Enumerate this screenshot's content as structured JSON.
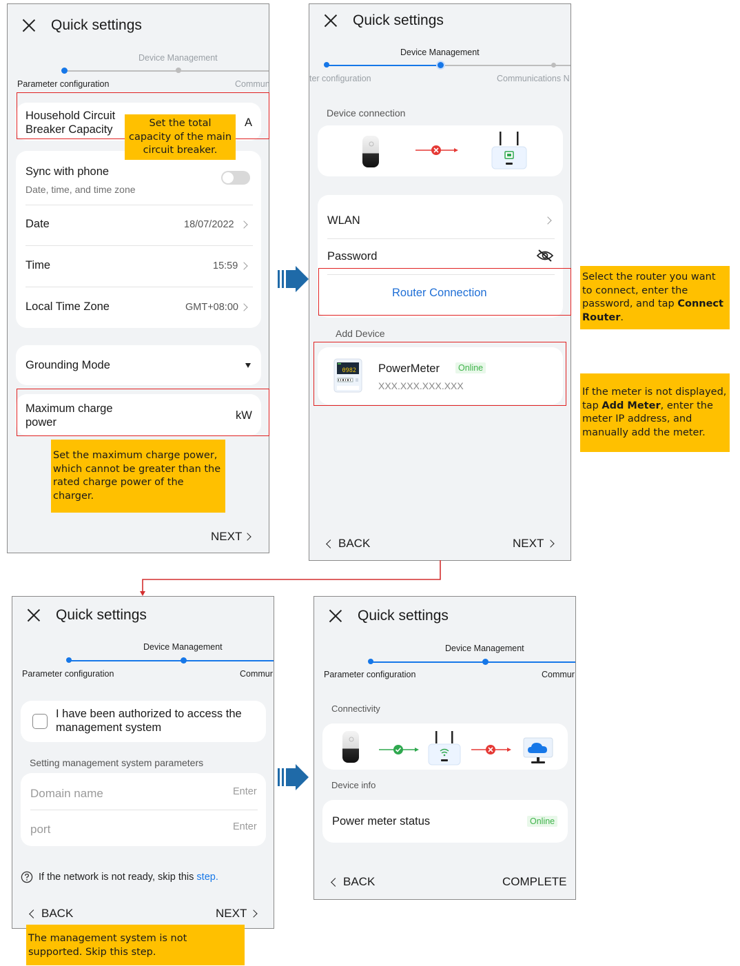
{
  "screen1": {
    "title": "Quick settings",
    "steps": {
      "device_management": "Device Management",
      "parameter_configuration": "Parameter configuration",
      "communications": "Commun"
    },
    "breaker": {
      "label_line1": "Household Circuit",
      "label_line2": "Breaker Capacity",
      "unit": "A"
    },
    "sync": {
      "label": "Sync with phone",
      "sub": "Date, time, and time zone"
    },
    "date": {
      "label": "Date",
      "value": "18/07/2022"
    },
    "time": {
      "label": "Time",
      "value": "15:59"
    },
    "timezone": {
      "label": "Local Time Zone",
      "value": "GMT+08:00"
    },
    "grounding": {
      "label": "Grounding Mode"
    },
    "max_power": {
      "label_line1": "Maximum charge",
      "label_line2": "power",
      "unit": "kW"
    },
    "next": "NEXT"
  },
  "screen2": {
    "title": "Quick settings",
    "steps": {
      "device_management": "Device Management",
      "parameter_configuration": "ter configuration",
      "communications": "Communications N"
    },
    "device_connection": "Device connection",
    "wlan": "WLAN",
    "password": "Password",
    "router_connection": "Router Connection",
    "add_device": "Add Device",
    "meter": {
      "name": "PowerMeter",
      "status": "Online",
      "ip": "XXX.XXX.XXX.XXX",
      "display": "0982"
    },
    "back": "BACK",
    "next": "NEXT"
  },
  "screen3": {
    "title": "Quick settings",
    "steps": {
      "device_management": "Device Management",
      "parameter_configuration": "Parameter configuration",
      "communications": "Commur"
    },
    "authorized_line1": "I have been authorized to access the",
    "authorized_line2": "management system",
    "section": "Setting management system parameters",
    "domain": {
      "placeholder": "Domain name",
      "hint": "Enter"
    },
    "port": {
      "placeholder": "port",
      "hint": "Enter"
    },
    "help_text": "If the network is not ready, skip this",
    "help_link": "step.",
    "back": "BACK",
    "next": "NEXT"
  },
  "screen4": {
    "title": "Quick settings",
    "steps": {
      "device_management": "Device Management",
      "parameter_configuration": "Parameter configuration",
      "communications": "Commur"
    },
    "connectivity": "Connectivity",
    "device_info": "Device info",
    "meter_status": {
      "label": "Power meter status",
      "value": "Online"
    },
    "back": "BACK",
    "complete": "COMPLETE"
  },
  "callouts": {
    "breaker": "Set the total capacity of the main circuit breaker.",
    "max_power": "Set the maximum charge power, which cannot be greater than the rated charge power of the charger.",
    "router_pre": "Select the router you want to connect, enter the password, and tap ",
    "router_bold": "Connect Router",
    "router_post": ".",
    "meter_pre": "If the meter is not displayed, tap ",
    "meter_bold": "Add Meter",
    "meter_post": ", enter the meter IP address, and manually add the meter.",
    "management": "The management system is not supported. Skip this step."
  },
  "colors": {
    "accent": "#1677e8",
    "callout": "#ffc000",
    "highlight_border": "#e02020",
    "online": "#3fb34a",
    "arrow": "#1f6aa8"
  },
  "icons": [
    "close-icon",
    "chevron-right-icon",
    "chevron-left-icon",
    "eye-off-icon",
    "charger-icon",
    "router-icon",
    "cloud-icon",
    "power-meter-icon",
    "help-icon",
    "flow-arrow-icon"
  ]
}
